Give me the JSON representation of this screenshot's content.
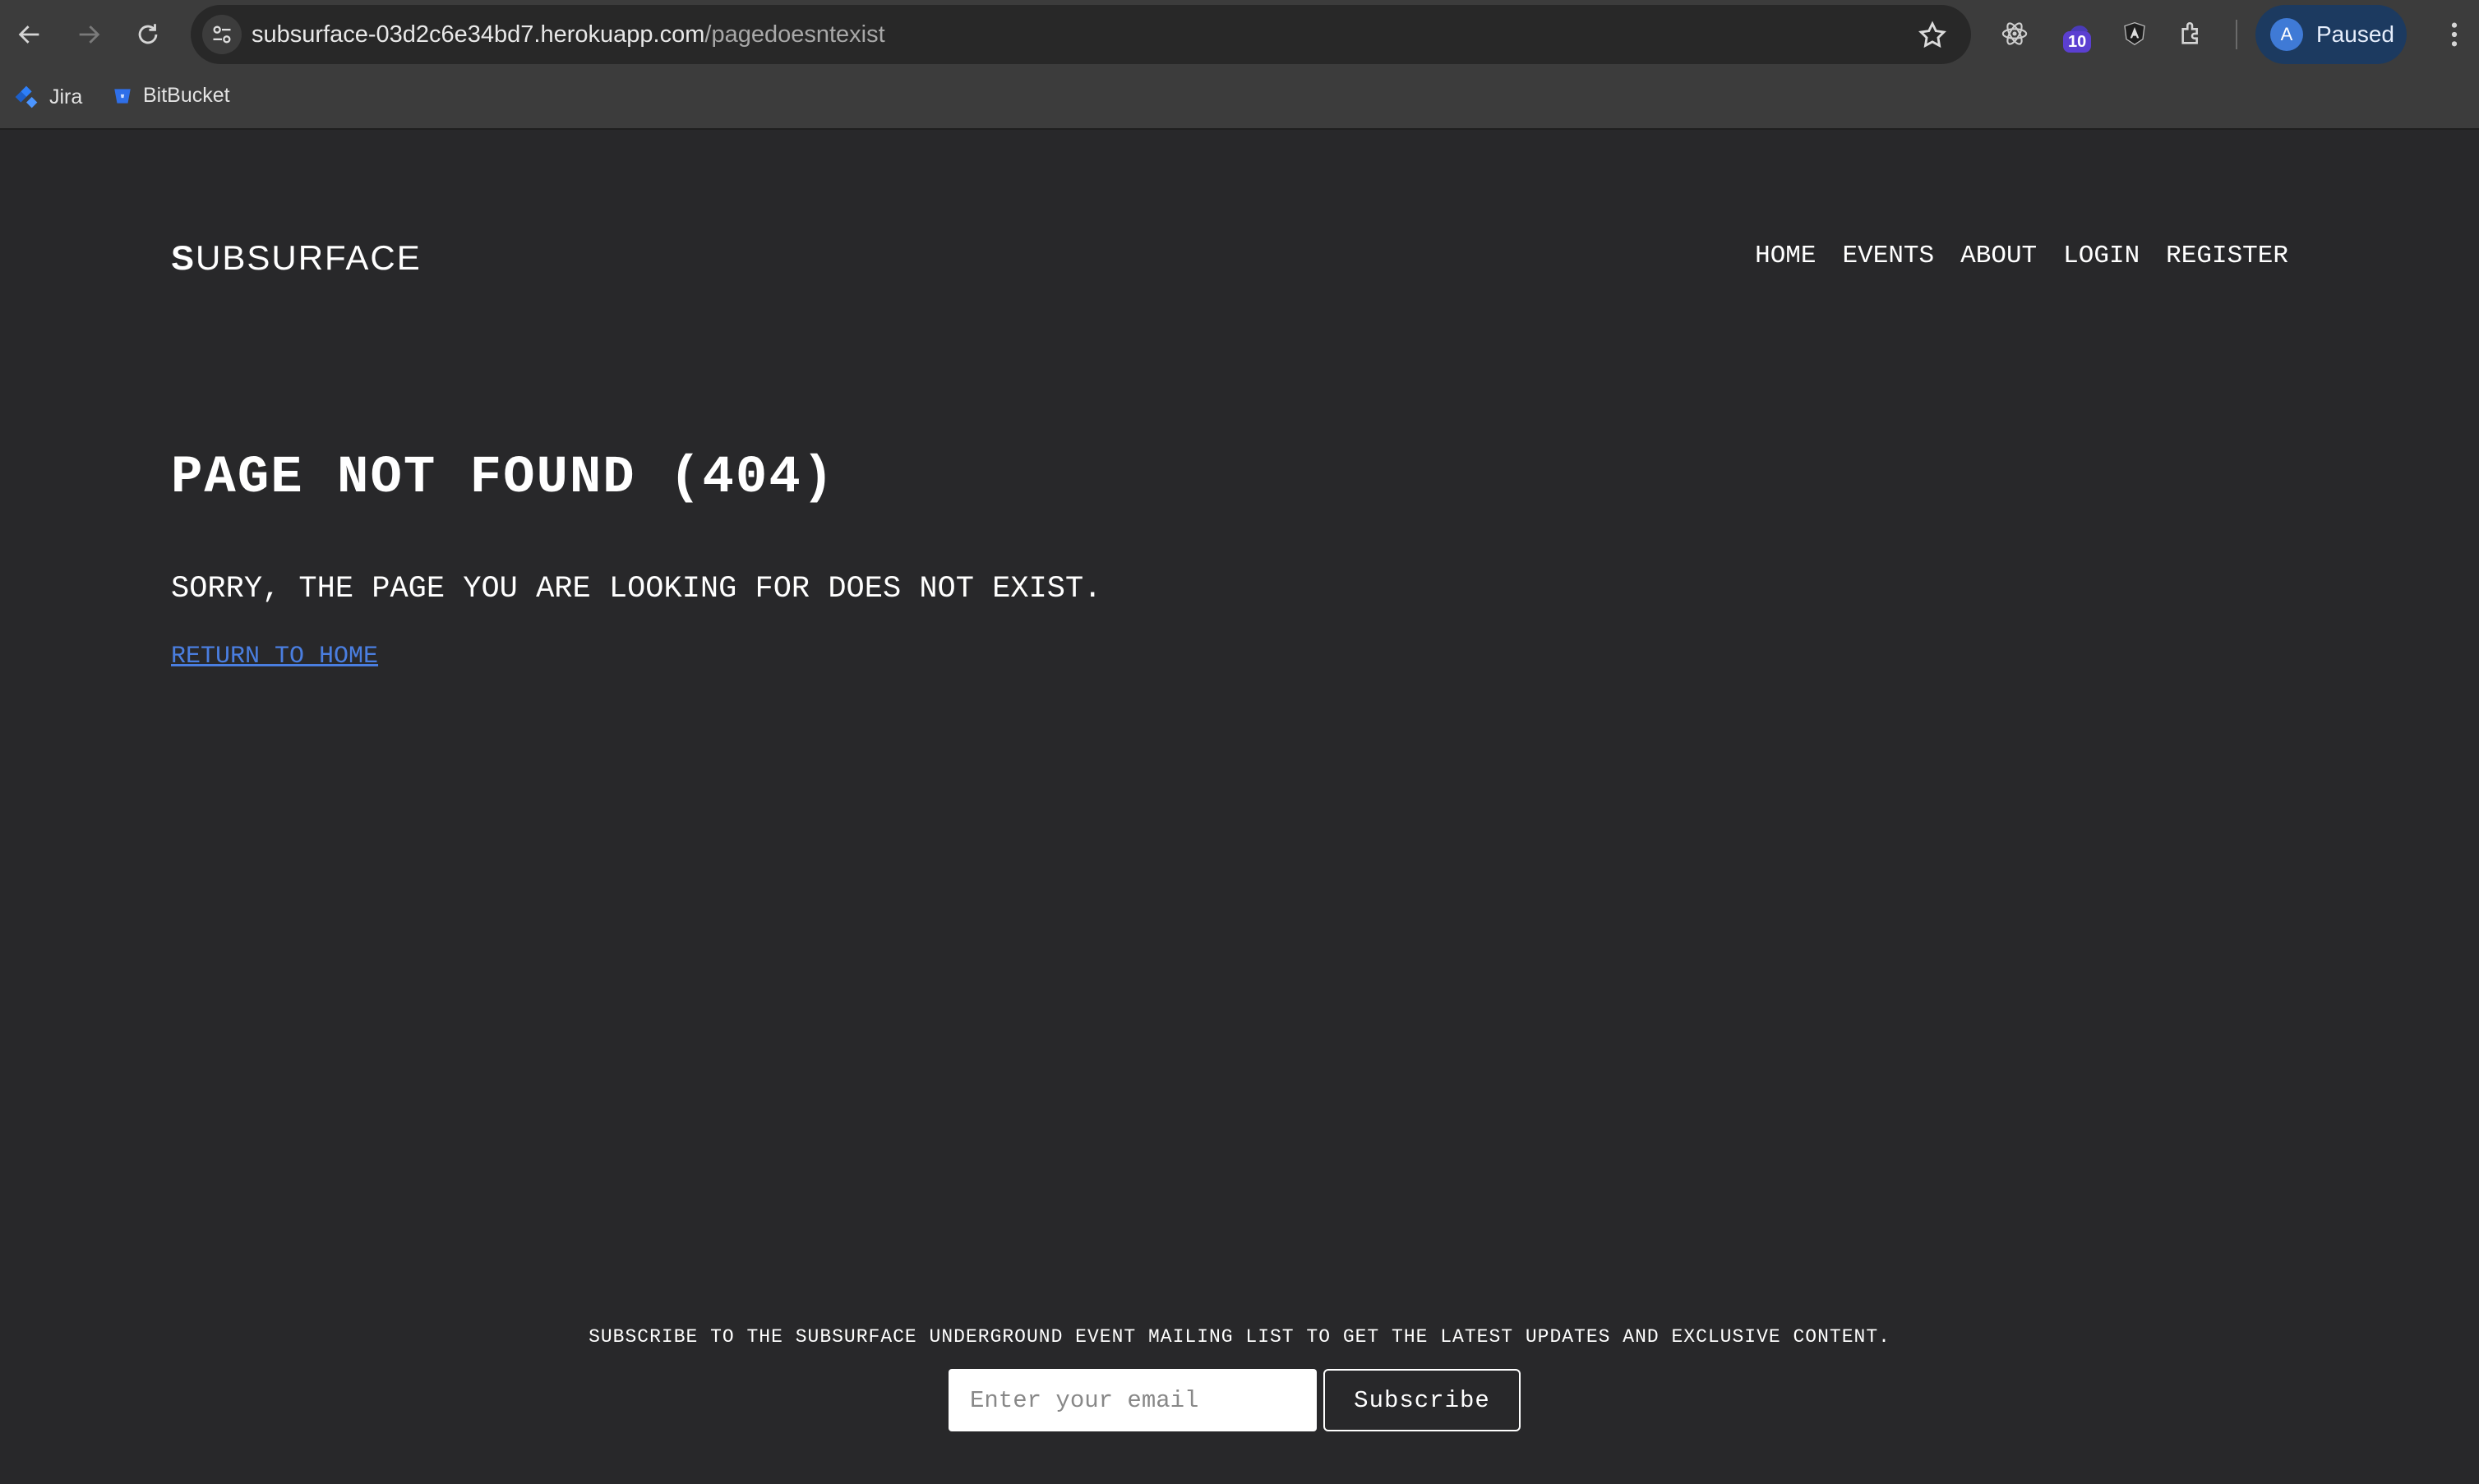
{
  "browser": {
    "url_host": "subsurface-03d2c6e34bd7.herokuapp.com",
    "url_path": "/pagedoesntexist",
    "extension_badge": "10",
    "profile_initial": "A",
    "profile_status": "Paused",
    "bookmarks": [
      {
        "label": "Jira",
        "icon": "jira-icon"
      },
      {
        "label": "BitBucket",
        "icon": "bitbucket-icon"
      }
    ]
  },
  "site": {
    "logo_first": "S",
    "logo_rest": "UBSURFACE",
    "nav": [
      "HOME",
      "EVENTS",
      "ABOUT",
      "LOGIN",
      "REGISTER"
    ]
  },
  "error": {
    "title": "PAGE NOT FOUND (404)",
    "message": "SORRY, THE PAGE YOU ARE LOOKING FOR DOES NOT EXIST.",
    "link": "RETURN TO HOME"
  },
  "footer": {
    "text": "SUBSCRIBE TO THE SUBSURFACE UNDERGROUND EVENT MAILING LIST TO GET THE LATEST UPDATES AND EXCLUSIVE CONTENT.",
    "email_placeholder": "Enter your email",
    "email_value": "",
    "button": "Subscribe"
  },
  "colors": {
    "page_bg": "#28282a",
    "link": "#4a7ee0",
    "chrome_bg": "#3c3c3c"
  }
}
